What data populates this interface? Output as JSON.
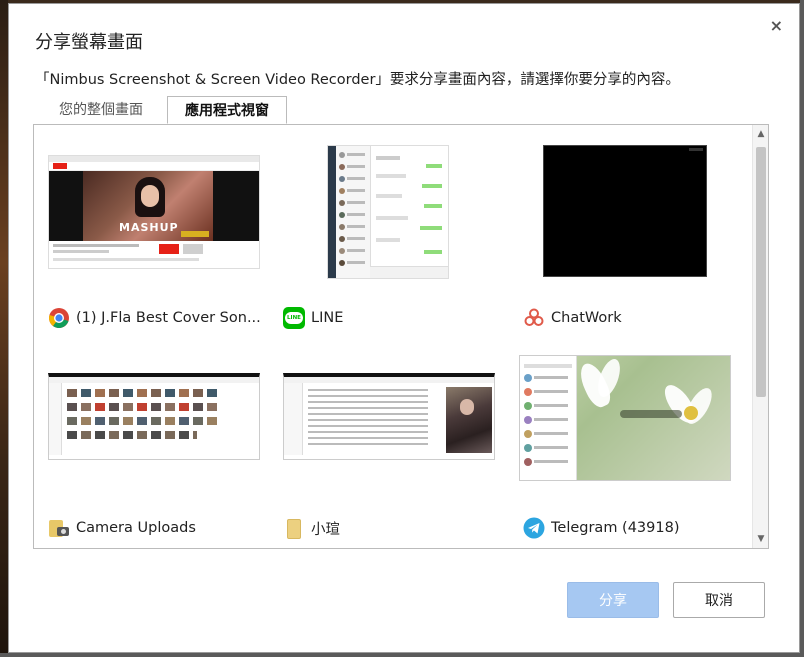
{
  "dialog": {
    "title": "分享螢幕畫面",
    "close_symbol": "×",
    "prompt": "「Nimbus Screenshot & Screen Video Recorder」要求分享畫面內容，請選擇你要分享的內容。"
  },
  "tabs": [
    {
      "label": "您的整個畫面",
      "active": false
    },
    {
      "label": "應用程式視窗",
      "active": true
    }
  ],
  "windows": [
    {
      "label": "(1) J.Fla Best Cover Son...",
      "icon": "chrome-icon",
      "thumb_caption": "MASHUP"
    },
    {
      "label": "LINE",
      "icon": "line-icon",
      "icon_text": "LINE"
    },
    {
      "label": "ChatWork",
      "icon": "chatwork-icon"
    },
    {
      "label": "Camera Uploads",
      "icon": "folder-camera-icon"
    },
    {
      "label": "小瑄",
      "icon": "folder-icon"
    },
    {
      "label": "Telegram (43918)",
      "icon": "telegram-icon"
    }
  ],
  "buttons": {
    "share": "分享",
    "cancel": "取消"
  },
  "scroll": {
    "up_arrow": "▲",
    "down_arrow": "▼"
  },
  "colors": {
    "share_button": "#a6c8f2",
    "line_green": "#00b900",
    "telegram_blue": "#2ca5e0",
    "chrome_red": "#db4437",
    "chrome_yellow": "#f4b400",
    "chrome_green": "#0f9d58",
    "chrome_blue": "#4285f4"
  }
}
